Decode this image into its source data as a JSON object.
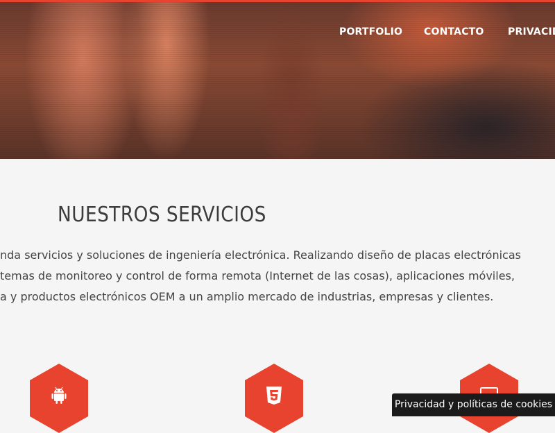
{
  "nav": {
    "items": [
      {
        "label": "PORTFOLIO"
      },
      {
        "label": "CONTACTO"
      },
      {
        "label": "PRIVACIDA"
      }
    ]
  },
  "services_section": {
    "title": "NUESTROS SERVICIOS",
    "description_lines": [
      "nda servicios y soluciones de ingeniería electrónica. Realizando diseño de placas electrónicas",
      "temas de monitoreo y control de forma remota (Internet de las cosas), aplicaciones móviles,",
      "a y productos electrónicos OEM a un amplio mercado de industrias, empresas y clientes."
    ],
    "cards": [
      {
        "icon": "android-icon"
      },
      {
        "icon": "html5-icon"
      },
      {
        "icon": "monitor-icon"
      }
    ]
  },
  "colors": {
    "accent": "#e8432f",
    "text": "#444444",
    "background": "#f5f5f5",
    "cookie_bg": "#1b1b1b"
  },
  "cookie_banner": {
    "label": "Privacidad y políticas de cookies"
  }
}
